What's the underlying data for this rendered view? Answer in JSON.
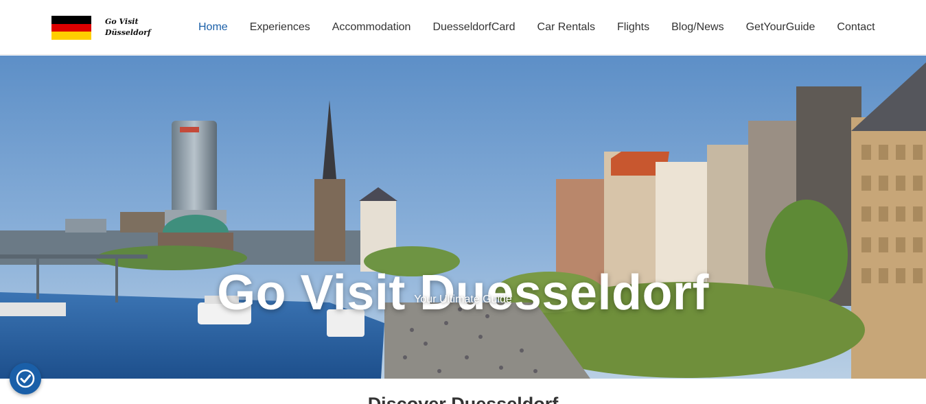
{
  "brand": {
    "logo_line1": "Go Visit",
    "logo_line2": "Düsseldorf",
    "flag_colors": [
      "#000000",
      "#dd0000",
      "#ffce00"
    ]
  },
  "nav": {
    "items": [
      {
        "label": "Home",
        "active": true
      },
      {
        "label": "Experiences",
        "active": false
      },
      {
        "label": "Accommodation",
        "active": false
      },
      {
        "label": "DuesseldorfCard",
        "active": false
      },
      {
        "label": "Car Rentals",
        "active": false
      },
      {
        "label": "Flights",
        "active": false
      },
      {
        "label": "Blog/News",
        "active": false
      },
      {
        "label": "GetYourGuide",
        "active": false
      },
      {
        "label": "Contact",
        "active": false
      }
    ],
    "active_color": "#1a5fa8"
  },
  "hero": {
    "title": "Go Visit Duesseldorf",
    "subtitle": "Your Ultimate Guide"
  },
  "section": {
    "title": "Discover Duesseldorf"
  },
  "accessibility": {
    "icon": "accessibility-check-icon",
    "color": "#1a5fa8"
  }
}
